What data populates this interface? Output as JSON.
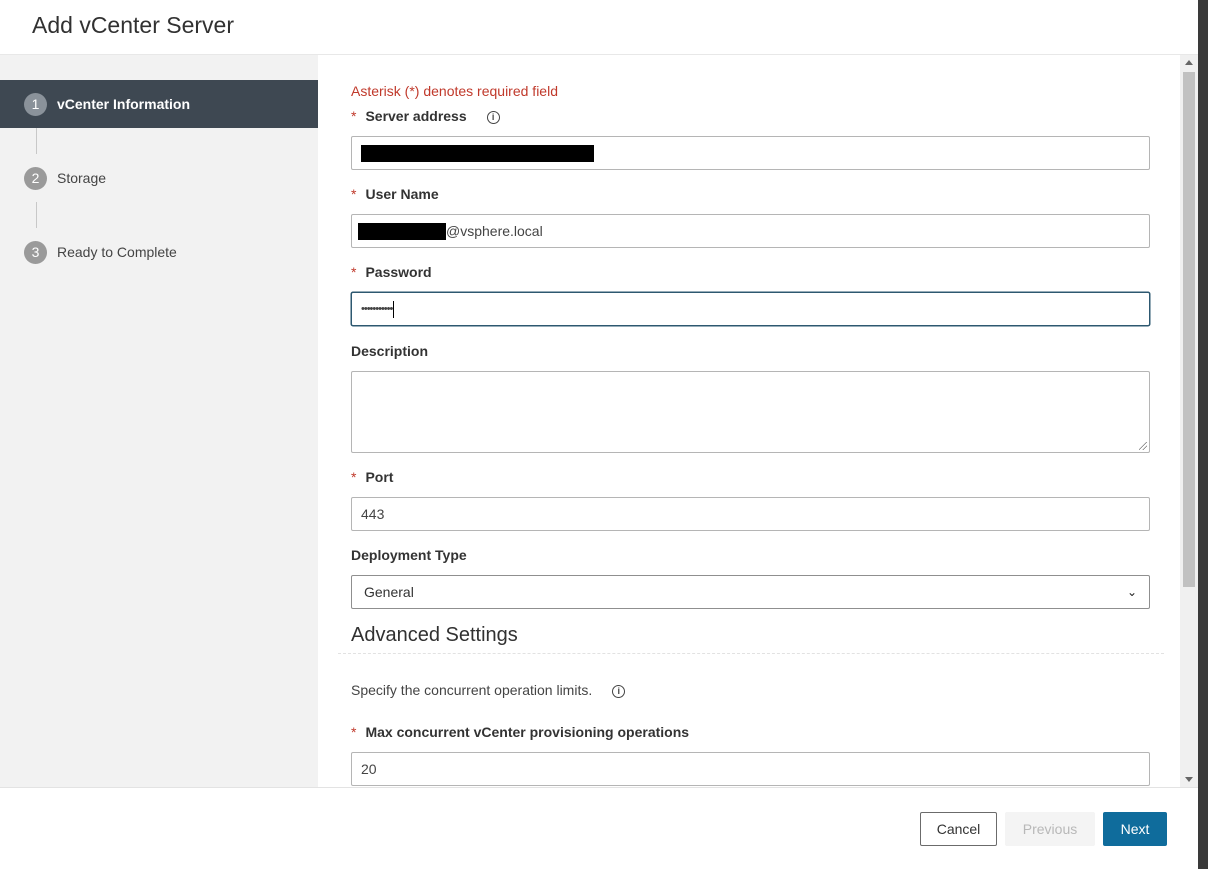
{
  "dialog": {
    "title": "Add vCenter Server"
  },
  "wizard": {
    "steps": [
      {
        "num": "1",
        "label": "vCenter Information"
      },
      {
        "num": "2",
        "label": "Storage"
      },
      {
        "num": "3",
        "label": "Ready to Complete"
      }
    ],
    "active_step": 1
  },
  "form": {
    "required_note": "Asterisk (*) denotes required field",
    "required_marker": "*",
    "info_glyph": "i",
    "server_address": {
      "label": "Server address",
      "value_redacted": true
    },
    "user_name": {
      "label": "User Name",
      "value_suffix": "@vsphere.local"
    },
    "password": {
      "label": "Password",
      "value": "•••••••••••"
    },
    "description": {
      "label": "Description",
      "value": ""
    },
    "port": {
      "label": "Port",
      "value": "443"
    },
    "deployment_type": {
      "label": "Deployment Type",
      "selected": "General",
      "chevron": "⌄"
    },
    "advanced": {
      "title": "Advanced Settings",
      "hint": "Specify the concurrent operation limits.",
      "max_ops_label": "Max concurrent vCenter provisioning operations",
      "max_ops_value": "20"
    }
  },
  "footer": {
    "cancel_label": "Cancel",
    "previous_label": "Previous",
    "next_label": "Next"
  },
  "colors": {
    "accent": "#0f6c9c",
    "required": "#c0392b",
    "sidebar_active": "#3e4852"
  },
  "icons": {
    "info": "info-icon",
    "select_arrow": "chevron-down-icon"
  }
}
